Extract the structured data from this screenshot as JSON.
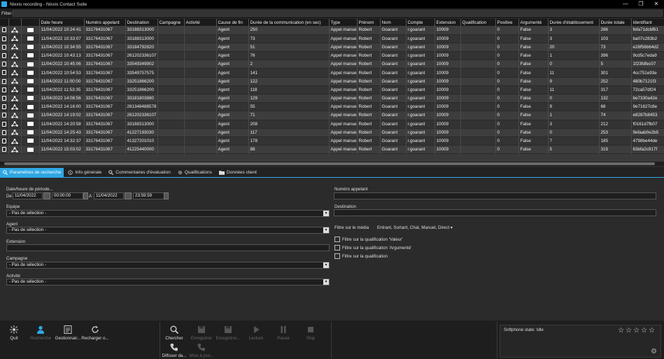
{
  "window": {
    "title": "Nixxis recording - Nixxis Contact Suite",
    "controls": [
      "—",
      "❐",
      "✕"
    ]
  },
  "filter": {
    "label": "Filter:",
    "value": ""
  },
  "grid": {
    "columns": [
      "",
      "",
      "",
      "Date heure",
      "Numéro appelant",
      "Destination",
      "Campagne",
      "Activité",
      "Cause de fin",
      "Durée de la communication (en sec)",
      "Type",
      "Prénom",
      "Nom",
      "Compte",
      "Extension",
      "Qualification",
      "Positive",
      "Argumenté",
      "Durée d'établissement",
      "Durée totale",
      "Identifiant"
    ],
    "rows": [
      [
        "11/04/2022 10:24:41",
        "33176431067",
        "33188313000",
        "",
        "",
        "Agent",
        "250",
        "Appel manuel",
        "Robert",
        "Goarant",
        "r.goarant",
        "10009",
        "",
        "0",
        "False",
        "3",
        "286",
        "fefa71dcbf61"
      ],
      [
        "11/04/2022 10:33:07",
        "33176431067",
        "33188313000",
        "",
        "",
        "Agent",
        "73",
        "Appel manuel",
        "Robert",
        "Goarant",
        "r.goarant",
        "10009",
        "",
        "0",
        "False",
        "3",
        "103",
        "ba07c283b2"
      ],
      [
        "11/04/2022 10:34:55",
        "33176431067",
        "33184792820",
        "",
        "",
        "Agent",
        "51",
        "Appel manuel",
        "Robert",
        "Goarant",
        "r.goarant",
        "10009",
        "",
        "0",
        "False",
        "20",
        "73",
        "e28f56b64d2"
      ],
      [
        "11/04/2022 10:43:13",
        "33176431067",
        "261202336107",
        "",
        "",
        "Agent",
        "76",
        "Appel manuel",
        "Robert",
        "Goarant",
        "r.goarant",
        "10009",
        "",
        "0",
        "False",
        "1",
        "396",
        "9cd5c7eda9"
      ],
      [
        "11/04/2022 10:45:06",
        "33176431067",
        "33549349902",
        "",
        "",
        "Agent",
        "2",
        "Appel manuel",
        "Robert",
        "Goarant",
        "r.goarant",
        "10009",
        "",
        "0",
        "False",
        "0",
        "5",
        "1f23fdfec07"
      ],
      [
        "11/04/2022 10:54:53",
        "33176431067",
        "33549757575",
        "",
        "",
        "Agent",
        "141",
        "Appel manuel",
        "Robert",
        "Goarant",
        "r.goarant",
        "10009",
        "",
        "0",
        "False",
        "11",
        "301",
        "4cc751e93e"
      ],
      [
        "11/04/2022 11:00:00",
        "33176431067",
        "33251866200",
        "",
        "",
        "Agent",
        "122",
        "Appel manuel",
        "Robert",
        "Goarant",
        "r.goarant",
        "10009",
        "",
        "0",
        "False",
        "9",
        "252",
        "480b7121f3"
      ],
      [
        "11/04/2022 11:53:35",
        "33176431067",
        "33251866200",
        "",
        "",
        "Agent",
        "118",
        "Appel manuel",
        "Robert",
        "Goarant",
        "r.goarant",
        "10009",
        "",
        "0",
        "False",
        "11",
        "317",
        "72ca57df24"
      ],
      [
        "11/04/2022 14:08:56",
        "33176431067",
        "33181803880",
        "",
        "",
        "Agent",
        "129",
        "Appel manuel",
        "Robert",
        "Goarant",
        "r.goarant",
        "10009",
        "",
        "0",
        "False",
        "0",
        "132",
        "be7330a42e"
      ],
      [
        "11/04/2022 14:16:00",
        "33176431067",
        "261348488578",
        "",
        "",
        "Agent",
        "55",
        "Appel manuel",
        "Robert",
        "Goarant",
        "r.goarant",
        "10009",
        "",
        "0",
        "False",
        "9",
        "68",
        "9e71627c8e"
      ],
      [
        "11/04/2022 14:19:02",
        "33176431067",
        "261202336107",
        "",
        "",
        "Agent",
        "71",
        "Appel manuel",
        "Robert",
        "Goarant",
        "r.goarant",
        "10009",
        "",
        "0",
        "False",
        "1",
        "74",
        "e8287b8453"
      ],
      [
        "11/04/2022 14:20:58",
        "33176431067",
        "33188313000",
        "",
        "",
        "Agent",
        "208",
        "Appel manuel",
        "Robert",
        "Goarant",
        "r.goarant",
        "10009",
        "",
        "0",
        "False",
        "3",
        "212",
        "f0161d7fb07"
      ],
      [
        "11/04/2022 14:25:43",
        "33176431067",
        "41227193030",
        "",
        "",
        "Agent",
        "117",
        "Appel manuel",
        "Robert",
        "Goarant",
        "r.goarant",
        "10009",
        "",
        "0",
        "False",
        "0",
        "253",
        "9efaab0e2b5"
      ],
      [
        "11/04/2022 14:32:37",
        "33176431067",
        "41327201010",
        "",
        "",
        "Agent",
        "178",
        "Appel manuel",
        "Robert",
        "Goarant",
        "r.goarant",
        "10009",
        "",
        "0",
        "False",
        "7",
        "185",
        "4798be44de"
      ],
      [
        "11/04/2022 15:03:02",
        "33176431067",
        "41225440000",
        "",
        "",
        "Agent",
        "88",
        "Appel manuel",
        "Robert",
        "Goarant",
        "r.goarant",
        "10009",
        "",
        "0",
        "False",
        "5",
        "319",
        "63bfa2c917f"
      ]
    ]
  },
  "tabs": [
    {
      "label": "Paramètres de recherche",
      "icon": "search-icon"
    },
    {
      "label": "Info générale",
      "icon": "info-icon"
    },
    {
      "label": "Commentaires d'évaluation",
      "icon": "search-icon"
    },
    {
      "label": "Qualifications",
      "icon": "gear-icon"
    },
    {
      "label": "Données client",
      "icon": "folder-icon"
    }
  ],
  "search": {
    "date_label": "Date/heure de période...",
    "de": "De",
    "a": "A",
    "date_from": "11/04/2022",
    "time_from": "00:00:00",
    "date_to": "11/04/2022",
    "time_to": "23:59:59",
    "equipe_label": "Equipe",
    "equipe_value": "- Pas de sélection -",
    "agent_label": "Agent",
    "agent_value": "- Pas de sélection -",
    "extension_label": "Extension",
    "extension_value": "",
    "campagne_label": "Campagne",
    "campagne_value": "- Pas de sélection -",
    "activite_label": "Activité",
    "activite_value": "- Pas de sélection -",
    "numero_label": "Numéro appelant",
    "numero_value": "",
    "destination_label": "Destination",
    "destination_value": "",
    "media_label": "Filtre sur le média",
    "media_value": "Entrant, Sortant, Chat, Manuel, Direct",
    "filter_valeur": "Filtre sur la qualification  'Valeur'",
    "filter_argumente": "Filtre sur la qualification  'Argumenté'",
    "filter_qualif": "Filtre sur la qualification"
  },
  "toolbar": {
    "quit": "Quit",
    "recherche": "Recherche",
    "gestionnaire": "Gestionnair...",
    "recharger": "Recharger o...",
    "chercher": "Chercher",
    "enregistrer": "Enregistrer",
    "enregistrer2": "Enregistrer...",
    "lecture": "Lecture",
    "pause": "Pause",
    "stop": "Stop",
    "diffuser": "Diffuser da...",
    "mise": "Mise à jour..."
  },
  "softphone": {
    "state": "Softphone state: Idle",
    "stars": "☆☆☆☆☆"
  },
  "colors": {
    "accent": "#2fa7e4",
    "background": "#2b2b2b"
  }
}
